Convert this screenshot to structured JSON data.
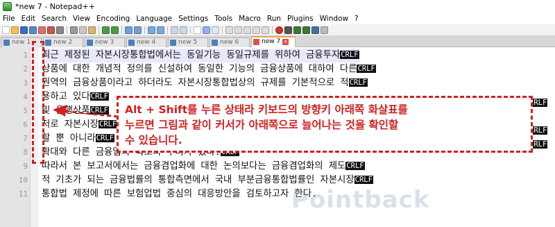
{
  "window": {
    "title": "*new 7 - Notepad++"
  },
  "menu": [
    "File",
    "Edit",
    "Search",
    "View",
    "Encoding",
    "Language",
    "Settings",
    "Tools",
    "Macro",
    "Run",
    "Plugins",
    "Window",
    "?"
  ],
  "tabs": [
    {
      "label": "new 1"
    },
    {
      "label": "new 2"
    },
    {
      "label": "new 3"
    },
    {
      "label": "new 4"
    },
    {
      "label": "new 5"
    },
    {
      "label": "new 6"
    },
    {
      "label": "new 7",
      "close": "×"
    }
  ],
  "editor": {
    "line_numbers": [
      "1",
      "2",
      "3",
      "4",
      "5",
      "6",
      "7",
      "8",
      "9",
      "10",
      "11"
    ],
    "lines": [
      {
        "text": " 최근 제정된 자본시장통합법에서는 동일기능 동일규제를 위하여 금융투자",
        "eol": "CRLF"
      },
      {
        "text": "상품에 대한 개념적 정의를 신설하여 동일한 기능의 금융상품에 대하여 다른",
        "eol": "CRLF"
      },
      {
        "text": "권역의 금융상품이라고 하더라도 자본시장통합법상의 규제를 기본적으로 적",
        "eol": "CRLF"
      },
      {
        "text": "용하고 있다",
        "eol": "CRLF"
      },
      {
        "text": "및 은행상품",
        "eol": "CRLF"
      },
      {
        "text": "저로 자본시장",
        "eol": "CRLF"
      },
      {
        "text": "할 뿐 아니라",
        "eol": "CRLF"
      },
      {
        "text": "확대와 다른 금융업의 축소의 우려가 있다.",
        "eol": "CRLF"
      },
      {
        "text": " 따라서 본 보고서에서는 금융겸업화에 대한 논의보다는 금융겸업화의 제도",
        "eol": "CRLF"
      },
      {
        "text": "적 기초가 되는 금융법률의 통합측면에서 국내 부분금융통합법률인 자본시장",
        "eol": "CRLF"
      },
      {
        "text": "통합법 제정에 따른 보험업법 중심의 대응방안을 검토하고자 한다.",
        "eol": ""
      }
    ],
    "right_eols": [
      "CRLF",
      "CRLF",
      "CRLF"
    ]
  },
  "annotation": {
    "text_lines": [
      "Alt + Shift를 누른 상태라 키보드의 방향키 아래쪽 화살표를",
      "누르면 그림과 같이 커서가 아래쪽으로 늘어나는 것을 확인할",
      "수 있습니다."
    ],
    "color": "#d12020"
  },
  "watermark": "Pointback"
}
